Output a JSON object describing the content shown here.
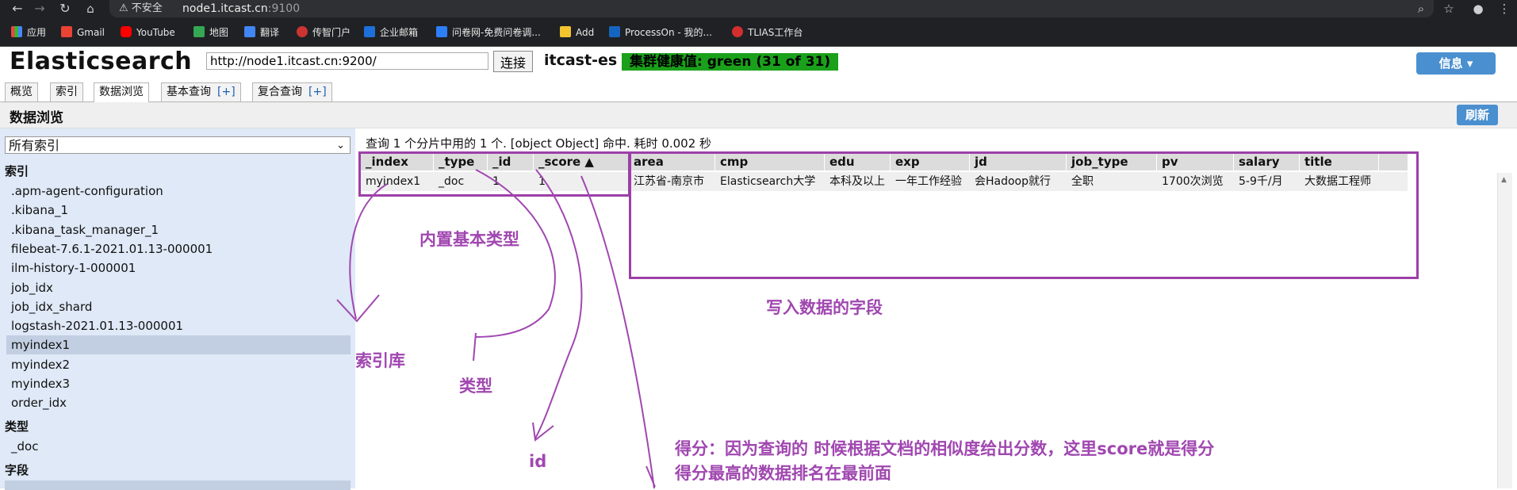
{
  "browser": {
    "security_label": "不安全",
    "url_host": "node1.itcast.cn",
    "url_port": ":9100",
    "bookmarks": [
      "应用",
      "Gmail",
      "YouTube",
      "地图",
      "翻译",
      "传智门户",
      "企业邮箱",
      "问卷网-免费问卷调...",
      "Add",
      "ProcessOn - 我的...",
      "TLIAS工作台"
    ]
  },
  "header": {
    "app_title": "Elasticsearch",
    "cluster_url": "http://node1.itcast.cn:9200/",
    "connect_label": "连接",
    "cluster_name": "itcast-es",
    "health_text": "集群健康值: green (31 of 31)",
    "info_label": "信息 ▾"
  },
  "tabs": [
    {
      "label": "概览",
      "plus": ""
    },
    {
      "label": "索引",
      "plus": ""
    },
    {
      "label": "数据浏览",
      "plus": ""
    },
    {
      "label": "基本查询",
      "plus": "[+]"
    },
    {
      "label": "复合查询",
      "plus": "[+]"
    }
  ],
  "section": {
    "title": "数据浏览",
    "refresh_label": "刷新"
  },
  "sidebar": {
    "select_value": "所有索引",
    "index_heading": "索引",
    "indices": [
      ".apm-agent-configuration",
      ".kibana_1",
      ".kibana_task_manager_1",
      "filebeat-7.6.1-2021.01.13-000001",
      "ilm-history-1-000001",
      "job_idx",
      "job_idx_shard",
      "logstash-2021.01.13-000001",
      "myindex1",
      "myindex2",
      "myindex3",
      "order_idx"
    ],
    "selected_index": "myindex1",
    "type_heading": "类型",
    "types": [
      "_doc"
    ],
    "field_heading": "字段"
  },
  "results": {
    "summary": "查询 1 个分片中用的 1 个. [object Object] 命中. 耗时 0.002 秒",
    "columns": [
      "_index",
      "_type",
      "_id",
      "_score ▲",
      "area",
      "cmp",
      "edu",
      "exp",
      "jd",
      "job_type",
      "pv",
      "salary",
      "title"
    ],
    "rows": [
      [
        "myindex1",
        "_doc",
        "1",
        "1",
        "江苏省-南京市",
        "Elasticsearch大学",
        "本科及以上",
        "一年工作经验",
        "会Hadoop就行",
        "全职",
        "1700次浏览",
        "5-9千/月",
        "大数据工程师"
      ]
    ]
  },
  "annotations": {
    "builtin_types": "内置基本类型",
    "index_lib": "索引库",
    "type_label": "类型",
    "id_label": "id",
    "written_fields": "写入数据的字段",
    "score_line1": "得分：因为查询的 时候根据文档的相似度给出分数，这里score就是得分",
    "score_line2": "得分最高的数据排名在最前面",
    "color": "#a047b0"
  }
}
